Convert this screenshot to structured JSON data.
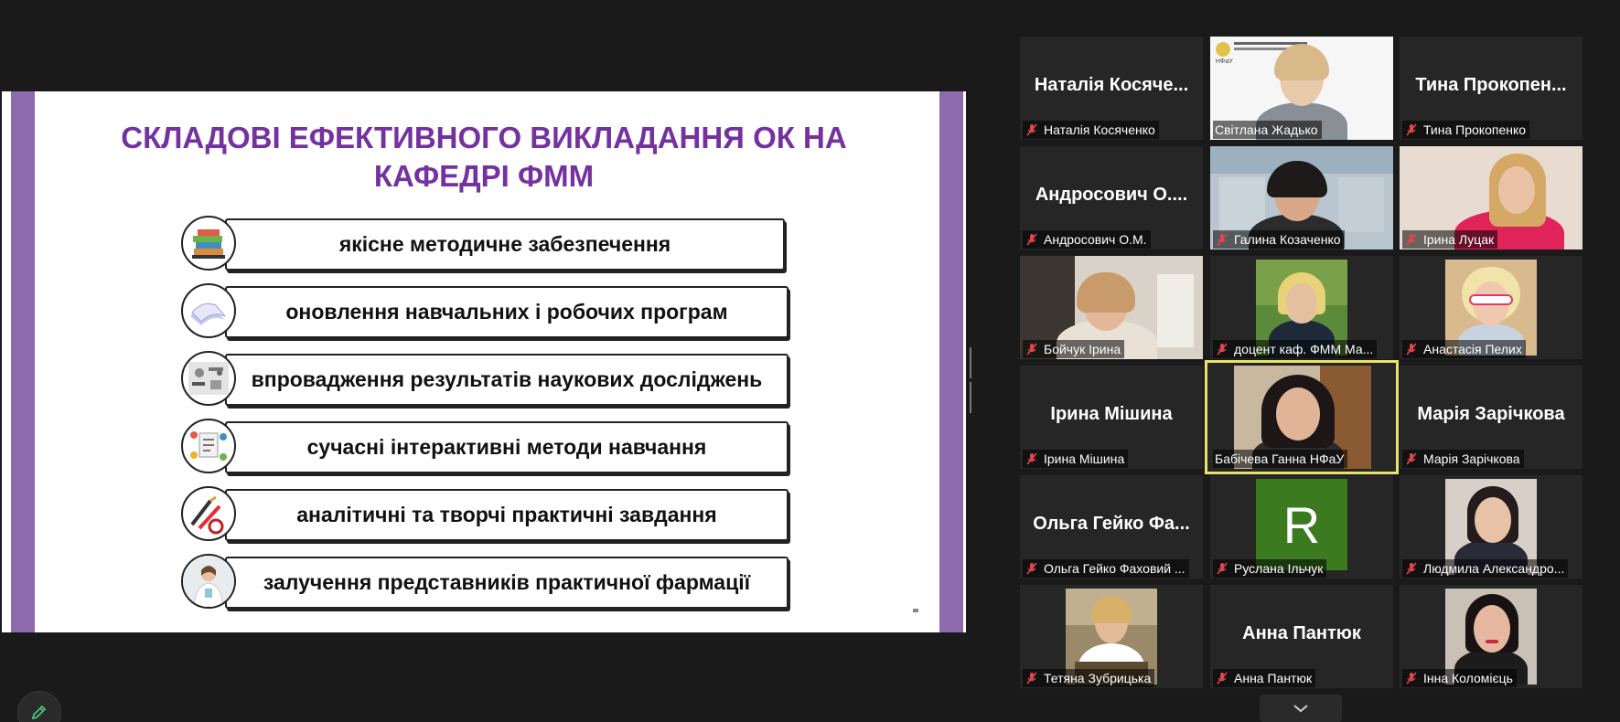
{
  "slide": {
    "title_line1": "СКЛАДОВІ ЕФЕКТИВНОГО ВИКЛАДАННЯ ОК НА",
    "title_line2": "КАФЕДРІ ФММ",
    "items": [
      {
        "text": "якісне методичне забезпечення",
        "icon": "books-icon"
      },
      {
        "text": "оновлення навчальних і робочих програм",
        "icon": "pages-icon"
      },
      {
        "text": "впровадження результатів наукових досліджень",
        "icon": "research-icon"
      },
      {
        "text": "сучасні інтерактивні методи навчання",
        "icon": "interactive-icon"
      },
      {
        "text": "аналітичні та творчі практичні завдання",
        "icon": "tools-icon"
      },
      {
        "text": "залучення представників практичної фармації",
        "icon": "pharmacist-icon"
      }
    ]
  },
  "participants": [
    {
      "big_name": "Наталія Косяче...",
      "label": "Наталія Косяченко",
      "muted": true,
      "type": "name"
    },
    {
      "label": "Світлана Жадько",
      "muted": false,
      "type": "video",
      "overlay_text": "НФаУ"
    },
    {
      "big_name": "Тина Прокопен...",
      "label": "Тина Прокопенко",
      "muted": true,
      "type": "name"
    },
    {
      "big_name": "Андросович О....",
      "label": "Андросович О.М.",
      "muted": true,
      "type": "name"
    },
    {
      "label": "Галина Козаченко",
      "muted": true,
      "type": "video"
    },
    {
      "label": "Ірина Луцак",
      "muted": true,
      "type": "video"
    },
    {
      "label": "Бойчук Ірина",
      "muted": true,
      "type": "video"
    },
    {
      "label": "доцент каф. ФММ Ма...",
      "muted": true,
      "type": "video"
    },
    {
      "label": "Анастасія Пелих",
      "muted": true,
      "type": "video"
    },
    {
      "big_name": "Ірина Мішина",
      "label": "Ірина Мішина",
      "muted": true,
      "type": "name"
    },
    {
      "label": "Бабічева Ганна НФаУ",
      "muted": false,
      "type": "video",
      "active": true
    },
    {
      "big_name": "Марія Зарічкова",
      "label": "Марія Зарічкова",
      "muted": true,
      "type": "name"
    },
    {
      "big_name": "Ольга Гейко Фа...",
      "label": "Ольга Гейко Фаховий ...",
      "muted": true,
      "type": "name"
    },
    {
      "label": "Руслана Ільчук",
      "muted": true,
      "type": "avatar",
      "initial": "R"
    },
    {
      "label": "Людмила Александро...",
      "muted": true,
      "type": "video"
    },
    {
      "label": "Тетяна Зубрицька",
      "muted": true,
      "type": "video"
    },
    {
      "big_name": "Анна Пантюк",
      "label": "Анна Пантюк",
      "muted": true,
      "type": "name"
    },
    {
      "label": "Інна Коломієць",
      "muted": true,
      "type": "video"
    }
  ],
  "colors": {
    "slide_title": "#7431a0",
    "slide_bar": "#8e6aae",
    "active_speaker": "#e7e36b",
    "mic_muted": "#e0464a",
    "avatar_green": "#3b7a1e"
  },
  "icons": {
    "annotate": "pencil-icon",
    "gallery_nav": "chevron-down-icon",
    "splitter": "drag-handle-icon"
  }
}
